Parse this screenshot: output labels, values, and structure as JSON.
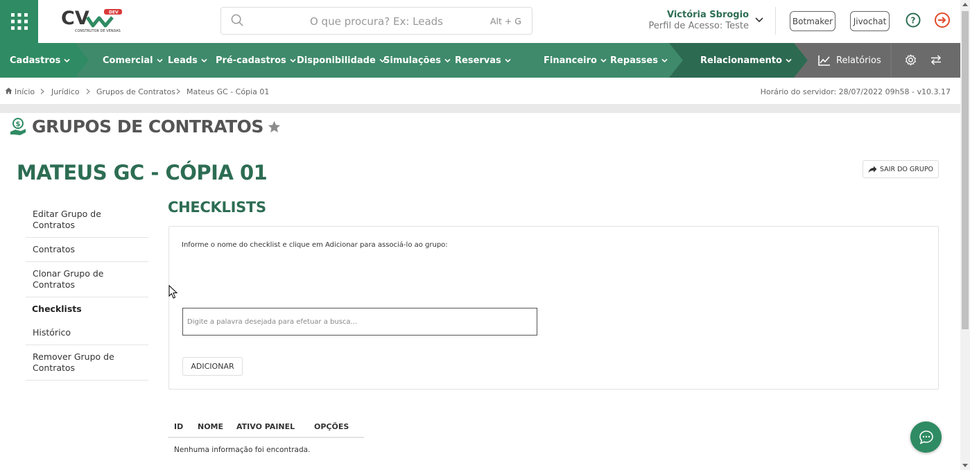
{
  "brand": {
    "logo_text": "CV",
    "logo_badge": "DEV",
    "logo_sub": "CONSTRUTOR DE VENDAS"
  },
  "search": {
    "placeholder": "O que procura? Ex: Leads",
    "shortcut": "Alt + G"
  },
  "user": {
    "name": "Victória Sbrogio",
    "role": "Perfil de Acesso: Teste"
  },
  "header_buttons": {
    "botmaker": "Botmaker",
    "jivochat": "Jivochat"
  },
  "nav": {
    "items": [
      {
        "label": "Cadastros"
      },
      {
        "label": "Comercial"
      },
      {
        "label": "Leads"
      },
      {
        "label": "Pré-cadastros"
      },
      {
        "label": "Disponibilidade"
      },
      {
        "label": "Simulações"
      },
      {
        "label": "Reservas"
      },
      {
        "label": "Financeiro"
      },
      {
        "label": "Repasses"
      },
      {
        "label": "Relacionamento"
      },
      {
        "label": "Relatórios"
      }
    ]
  },
  "breadcrumb": {
    "items": [
      {
        "label": "Início"
      },
      {
        "label": "Jurídico"
      },
      {
        "label": "Grupos de Contratos"
      },
      {
        "label": "Mateus GC - Cópia 01"
      }
    ],
    "server_time": "Horário do servidor: 28/07/2022 09h58 - v10.3.17"
  },
  "page": {
    "title": "GRUPOS DE CONTRATOS",
    "group_title": "MATEUS GC - CÓPIA 01",
    "leave_button": "SAIR DO GRUPO"
  },
  "sidebar": {
    "items": [
      {
        "label": "Editar Grupo de Contratos"
      },
      {
        "label": "Contratos"
      },
      {
        "label": "Clonar Grupo de Contratos"
      },
      {
        "label": "Checklists"
      },
      {
        "label": "Histórico"
      },
      {
        "label": "Remover Grupo de Contratos"
      }
    ]
  },
  "checklists": {
    "title": "CHECKLISTS",
    "info": "Informe o nome do checklist e clique em Adicionar para associá-lo ao grupo:",
    "input_placeholder": "Digite a palavra desejada para efetuar a busca...",
    "add_button": "ADICIONAR",
    "columns": [
      "ID",
      "NOME",
      "ATIVO PAINEL",
      "OPÇÕES"
    ],
    "empty_text": "Nenhuma informação foi encontrada."
  },
  "colors": {
    "primary": "#3e8a6a",
    "dark_green": "#2d6d53",
    "nav_dark": "#2d6a52",
    "nav_grey": "#6b6b6b",
    "logout_red": "#e24b2b"
  }
}
